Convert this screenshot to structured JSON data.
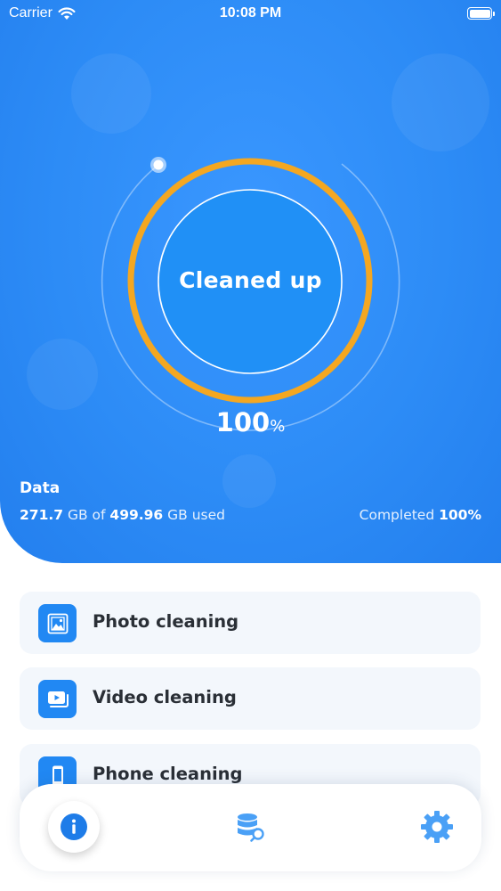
{
  "status_bar": {
    "carrier": "Carrier",
    "time": "10:08 PM"
  },
  "gauge": {
    "label": "Cleaned up",
    "percent_value": "100",
    "percent_unit": "%",
    "progress_fraction": 1.0
  },
  "storage": {
    "title": "Data",
    "used": "271.7",
    "unit1": " GB of ",
    "total": "499.96",
    "unit2": " GB used",
    "completed_label": "Completed ",
    "completed_value": "100%"
  },
  "cards": [
    {
      "label": "Photo cleaning",
      "icon": "photo-icon"
    },
    {
      "label": "Video cleaning",
      "icon": "video-icon"
    },
    {
      "label": "Phone cleaning",
      "icon": "phone-icon"
    }
  ],
  "tabs": [
    {
      "icon": "info-icon",
      "active": true
    },
    {
      "icon": "database-search-icon",
      "active": false
    },
    {
      "icon": "gear-icon",
      "active": false
    }
  ],
  "colors": {
    "primary": "#2d8cf6",
    "ring": "#f4a721",
    "card_bg": "#f3f7fc",
    "tab_icon": "#4aa0f6"
  }
}
